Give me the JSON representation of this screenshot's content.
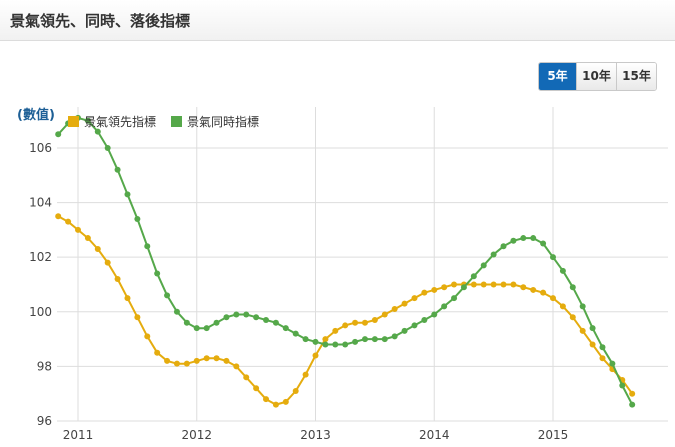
{
  "header": {
    "title": "景氣領先、同時、落後指標"
  },
  "range_tabs": [
    {
      "label": "5年",
      "active": true
    },
    {
      "label": "10年",
      "active": false
    },
    {
      "label": "15年",
      "active": false
    }
  ],
  "colors": {
    "leading": "#e5ac0e",
    "coincident": "#55a84a",
    "grid": "#dddddd",
    "axis_text": "#444444",
    "active_tab": "#1269b6"
  },
  "chart_data": {
    "type": "line",
    "unit_label": "(數值)",
    "x_ticks": [
      "2011",
      "2012",
      "2013",
      "2014",
      "2015"
    ],
    "y_ticks": [
      96,
      98,
      100,
      102,
      104,
      106
    ],
    "ylim": [
      96,
      107.5
    ],
    "xlim": [
      "2010-11",
      "2015-09"
    ],
    "grid": true,
    "legend_position": "top-left",
    "series": [
      {
        "name": "景氣領先指標",
        "color": "#e5ac0e",
        "points": [
          [
            "2010-11",
            103.5
          ],
          [
            "2010-12",
            103.3
          ],
          [
            "2011-01",
            103.0
          ],
          [
            "2011-02",
            102.7
          ],
          [
            "2011-03",
            102.3
          ],
          [
            "2011-04",
            101.8
          ],
          [
            "2011-05",
            101.2
          ],
          [
            "2011-06",
            100.5
          ],
          [
            "2011-07",
            99.8
          ],
          [
            "2011-08",
            99.1
          ],
          [
            "2011-09",
            98.5
          ],
          [
            "2011-10",
            98.2
          ],
          [
            "2011-11",
            98.1
          ],
          [
            "2011-12",
            98.1
          ],
          [
            "2012-01",
            98.2
          ],
          [
            "2012-02",
            98.3
          ],
          [
            "2012-03",
            98.3
          ],
          [
            "2012-04",
            98.2
          ],
          [
            "2012-05",
            98.0
          ],
          [
            "2012-06",
            97.6
          ],
          [
            "2012-07",
            97.2
          ],
          [
            "2012-08",
            96.8
          ],
          [
            "2012-09",
            96.6
          ],
          [
            "2012-10",
            96.7
          ],
          [
            "2012-11",
            97.1
          ],
          [
            "2012-12",
            97.7
          ],
          [
            "2013-01",
            98.4
          ],
          [
            "2013-02",
            99.0
          ],
          [
            "2013-03",
            99.3
          ],
          [
            "2013-04",
            99.5
          ],
          [
            "2013-05",
            99.6
          ],
          [
            "2013-06",
            99.6
          ],
          [
            "2013-07",
            99.7
          ],
          [
            "2013-08",
            99.9
          ],
          [
            "2013-09",
            100.1
          ],
          [
            "2013-10",
            100.3
          ],
          [
            "2013-11",
            100.5
          ],
          [
            "2013-12",
            100.7
          ],
          [
            "2014-01",
            100.8
          ],
          [
            "2014-02",
            100.9
          ],
          [
            "2014-03",
            101.0
          ],
          [
            "2014-04",
            101.0
          ],
          [
            "2014-05",
            101.0
          ],
          [
            "2014-06",
            101.0
          ],
          [
            "2014-07",
            101.0
          ],
          [
            "2014-08",
            101.0
          ],
          [
            "2014-09",
            101.0
          ],
          [
            "2014-10",
            100.9
          ],
          [
            "2014-11",
            100.8
          ],
          [
            "2014-12",
            100.7
          ],
          [
            "2015-01",
            100.5
          ],
          [
            "2015-02",
            100.2
          ],
          [
            "2015-03",
            99.8
          ],
          [
            "2015-04",
            99.3
          ],
          [
            "2015-05",
            98.8
          ],
          [
            "2015-06",
            98.3
          ],
          [
            "2015-07",
            97.9
          ],
          [
            "2015-08",
            97.5
          ],
          [
            "2015-09",
            97.0
          ]
        ]
      },
      {
        "name": "景氣同時指標",
        "color": "#55a84a",
        "points": [
          [
            "2010-11",
            106.5
          ],
          [
            "2010-12",
            106.9
          ],
          [
            "2011-01",
            107.1
          ],
          [
            "2011-02",
            107.0
          ],
          [
            "2011-03",
            106.6
          ],
          [
            "2011-04",
            106.0
          ],
          [
            "2011-05",
            105.2
          ],
          [
            "2011-06",
            104.3
          ],
          [
            "2011-07",
            103.4
          ],
          [
            "2011-08",
            102.4
          ],
          [
            "2011-09",
            101.4
          ],
          [
            "2011-10",
            100.6
          ],
          [
            "2011-11",
            100.0
          ],
          [
            "2011-12",
            99.6
          ],
          [
            "2012-01",
            99.4
          ],
          [
            "2012-02",
            99.4
          ],
          [
            "2012-03",
            99.6
          ],
          [
            "2012-04",
            99.8
          ],
          [
            "2012-05",
            99.9
          ],
          [
            "2012-06",
            99.9
          ],
          [
            "2012-07",
            99.8
          ],
          [
            "2012-08",
            99.7
          ],
          [
            "2012-09",
            99.6
          ],
          [
            "2012-10",
            99.4
          ],
          [
            "2012-11",
            99.2
          ],
          [
            "2012-12",
            99.0
          ],
          [
            "2013-01",
            98.9
          ],
          [
            "2013-02",
            98.8
          ],
          [
            "2013-03",
            98.8
          ],
          [
            "2013-04",
            98.8
          ],
          [
            "2013-05",
            98.9
          ],
          [
            "2013-06",
            99.0
          ],
          [
            "2013-07",
            99.0
          ],
          [
            "2013-08",
            99.0
          ],
          [
            "2013-09",
            99.1
          ],
          [
            "2013-10",
            99.3
          ],
          [
            "2013-11",
            99.5
          ],
          [
            "2013-12",
            99.7
          ],
          [
            "2014-01",
            99.9
          ],
          [
            "2014-02",
            100.2
          ],
          [
            "2014-03",
            100.5
          ],
          [
            "2014-04",
            100.9
          ],
          [
            "2014-05",
            101.3
          ],
          [
            "2014-06",
            101.7
          ],
          [
            "2014-07",
            102.1
          ],
          [
            "2014-08",
            102.4
          ],
          [
            "2014-09",
            102.6
          ],
          [
            "2014-10",
            102.7
          ],
          [
            "2014-11",
            102.7
          ],
          [
            "2014-12",
            102.5
          ],
          [
            "2015-01",
            102.0
          ],
          [
            "2015-02",
            101.5
          ],
          [
            "2015-03",
            100.9
          ],
          [
            "2015-04",
            100.2
          ],
          [
            "2015-05",
            99.4
          ],
          [
            "2015-06",
            98.7
          ],
          [
            "2015-07",
            98.1
          ],
          [
            "2015-08",
            97.3
          ],
          [
            "2015-09",
            96.6
          ]
        ]
      }
    ]
  }
}
